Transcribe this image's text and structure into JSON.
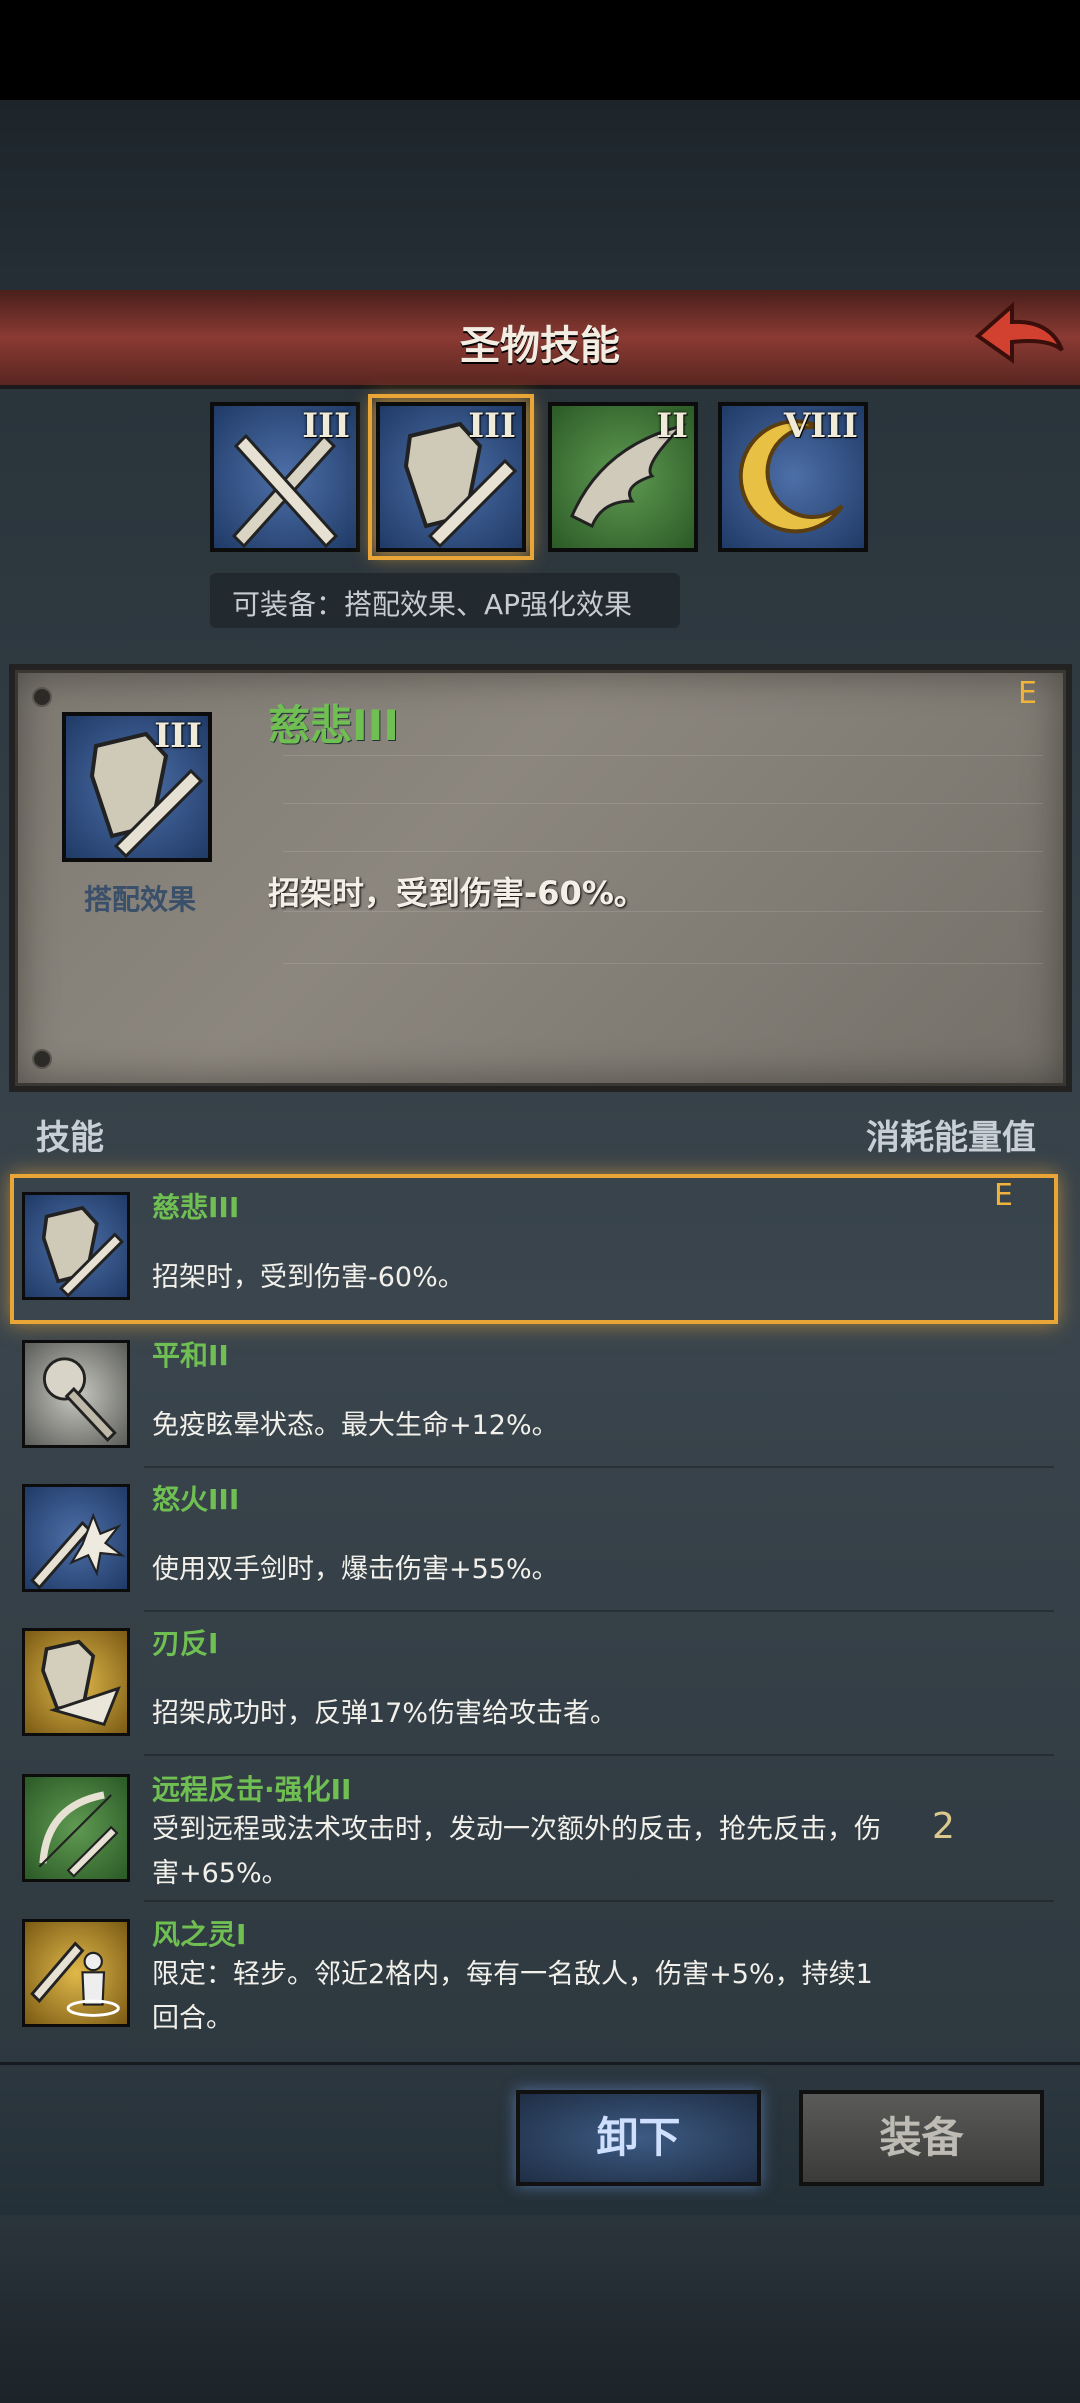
{
  "header": {
    "title": "圣物技能"
  },
  "relics": [
    {
      "level": "III",
      "name": "crossed-swords-relic",
      "color": "#2e4f86"
    },
    {
      "level": "III",
      "name": "shield-sword-relic",
      "color": "#2e4f86",
      "selected": true
    },
    {
      "level": "II",
      "name": "wing-relic",
      "color": "#3f7a3a"
    },
    {
      "level": "VIII",
      "name": "moon-relic",
      "color": "#2e4f86"
    }
  ],
  "equip_info": "可装备：搭配效果、AP强化效果",
  "detail": {
    "icon_level": "III",
    "icon_label": "搭配效果",
    "name": "慈悲III",
    "description": "招架时，受到伤害-60%。",
    "rank": "E"
  },
  "list_headers": {
    "left": "技能",
    "right": "消耗能量值"
  },
  "skills": [
    {
      "name": "慈悲III",
      "description": "招架时，受到伤害-60%。",
      "rank": "E",
      "cost": "",
      "icon": "shield-sword-icon"
    },
    {
      "name": "平和II",
      "description": "免疫眩晕状态。最大生命+12%。",
      "rank": "",
      "cost": "",
      "icon": "spiked-mace-icon"
    },
    {
      "name": "怒火III",
      "description": "使用双手剑时，爆击伤害+55%。",
      "rank": "",
      "cost": "",
      "icon": "sword-burst-icon"
    },
    {
      "name": "刃反I",
      "description": "招架成功时，反弹17%伤害给攻击者。",
      "rank": "",
      "cost": "",
      "icon": "shield-deflect-icon"
    },
    {
      "name": "远程反击·强化II",
      "description": "受到远程或法术攻击时，发动一次额外的反击，抢先反击，伤害+65%。",
      "rank": "",
      "cost": "2",
      "icon": "bow-arrow-icon"
    },
    {
      "name": "风之灵I",
      "description": "限定：轻步。邻近2格内，每有一名敌人，伤害+5%，持续1回合。",
      "rank": "",
      "cost": "",
      "icon": "wind-spirit-icon"
    }
  ],
  "buttons": {
    "unequip": "卸下",
    "equip": "装备"
  }
}
